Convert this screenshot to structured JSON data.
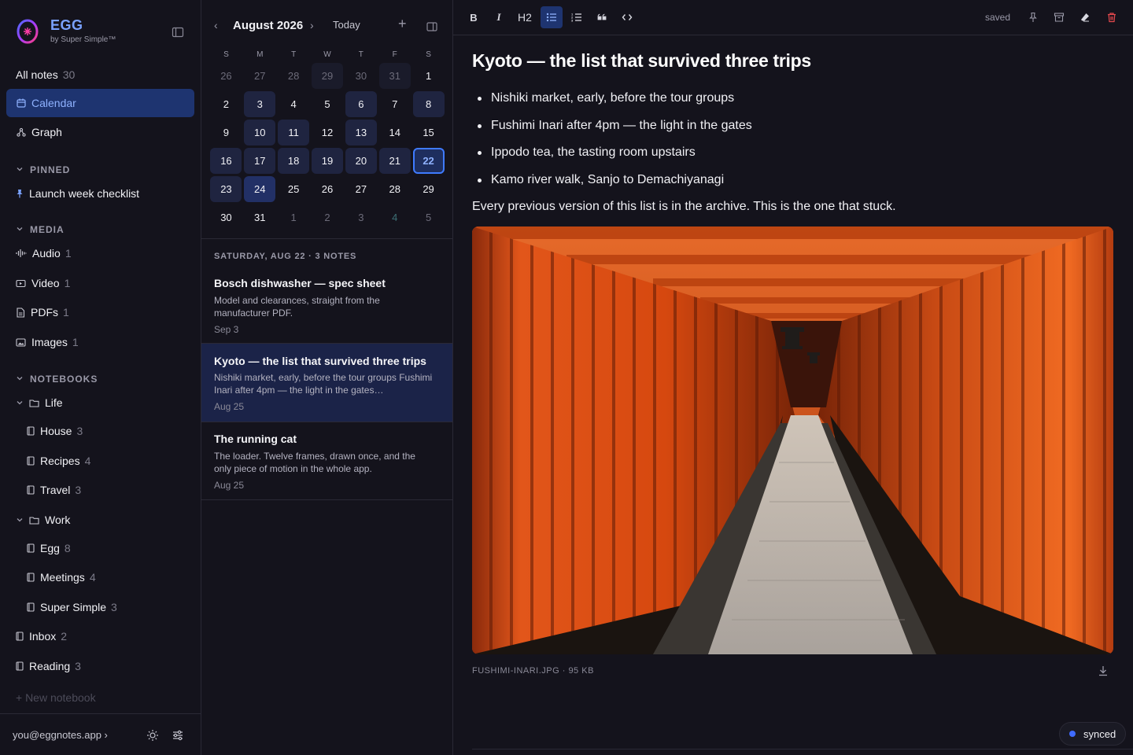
{
  "brand": {
    "name": "EGG",
    "sub": "by Super Simple™"
  },
  "nav": {
    "all_notes": {
      "label": "All notes",
      "count": "30"
    },
    "calendar": {
      "label": "Calendar"
    },
    "graph": {
      "label": "Graph"
    }
  },
  "pinned": {
    "heading": "PINNED",
    "items": [
      "Launch week checklist"
    ]
  },
  "media": {
    "heading": "MEDIA",
    "items": [
      {
        "label": "Audio",
        "count": "1",
        "icon": "waveform-icon"
      },
      {
        "label": "Video",
        "count": "1",
        "icon": "video-icon"
      },
      {
        "label": "PDFs",
        "count": "1",
        "icon": "pdf-icon"
      },
      {
        "label": "Images",
        "count": "1",
        "icon": "image-icon"
      }
    ]
  },
  "notebooks": {
    "heading": "NOTEBOOKS",
    "life": {
      "label": "Life"
    },
    "life_children": [
      {
        "label": "House",
        "count": "3"
      },
      {
        "label": "Recipes",
        "count": "4"
      },
      {
        "label": "Travel",
        "count": "3"
      }
    ],
    "work": {
      "label": "Work"
    },
    "work_children": [
      {
        "label": "Egg",
        "count": "8"
      },
      {
        "label": "Meetings",
        "count": "4"
      },
      {
        "label": "Super Simple",
        "count": "3"
      }
    ],
    "inbox": {
      "label": "Inbox",
      "count": "2"
    },
    "reading": {
      "label": "Reading",
      "count": "3"
    },
    "new_notebook": "+ New notebook"
  },
  "footer": {
    "account": "you@eggnotes.app ›"
  },
  "calendar": {
    "month": "August 2026",
    "today_label": "Today",
    "weekdays": [
      "S",
      "M",
      "T",
      "W",
      "T",
      "F",
      "S"
    ],
    "weeks": [
      [
        "26",
        "27",
        "28",
        "29",
        "30",
        "31",
        "1"
      ],
      [
        "2",
        "3",
        "4",
        "5",
        "6",
        "7",
        "8"
      ],
      [
        "9",
        "10",
        "11",
        "12",
        "13",
        "14",
        "15"
      ],
      [
        "16",
        "17",
        "18",
        "19",
        "20",
        "21",
        "22"
      ],
      [
        "23",
        "24",
        "25",
        "26",
        "27",
        "28",
        "29"
      ],
      [
        "30",
        "31",
        "1",
        "2",
        "3",
        "4",
        "5"
      ]
    ],
    "selected_day": "22",
    "notes_heading": "SATURDAY, AUG 22 · 3 NOTES"
  },
  "notes": [
    {
      "title": "Bosch dishwasher — spec sheet",
      "excerpt": "Model and clearances, straight from the manufacturer PDF.",
      "date": "Sep 3"
    },
    {
      "title": "Kyoto — the list that survived three trips",
      "excerpt": "Nishiki market, early, before the tour groups Fushimi Inari after 4pm — the light in the gates…",
      "date": "Aug 25"
    },
    {
      "title": "The running cat",
      "excerpt": "The loader. Twelve frames, drawn once, and the only piece of motion in the whole app.",
      "date": "Aug 25"
    }
  ],
  "toolbar": {
    "bold": "B",
    "italic": "I",
    "h2": "H2",
    "saved": "saved"
  },
  "document": {
    "title": "Kyoto — the list that survived three trips",
    "bullets": [
      "Nishiki market, early, before the tour groups",
      "Fushimi Inari after 4pm — the light in the gates",
      "Ippodo tea, the tasting room upstairs",
      "Kamo river walk, Sanjo to Demachiyanagi"
    ],
    "paragraph": "Every previous version of this list is in the archive. This is the one that stuck.",
    "attachment_caption": "FUSHIMI-INARI.JPG · 95 KB"
  },
  "status": {
    "synced": "synced"
  },
  "colors": {
    "background": "#14131c",
    "accent": "#3f7bff",
    "accent_text": "#8fb2ff",
    "active_bg": "#1e3470",
    "delete_red": "#e5484d"
  }
}
